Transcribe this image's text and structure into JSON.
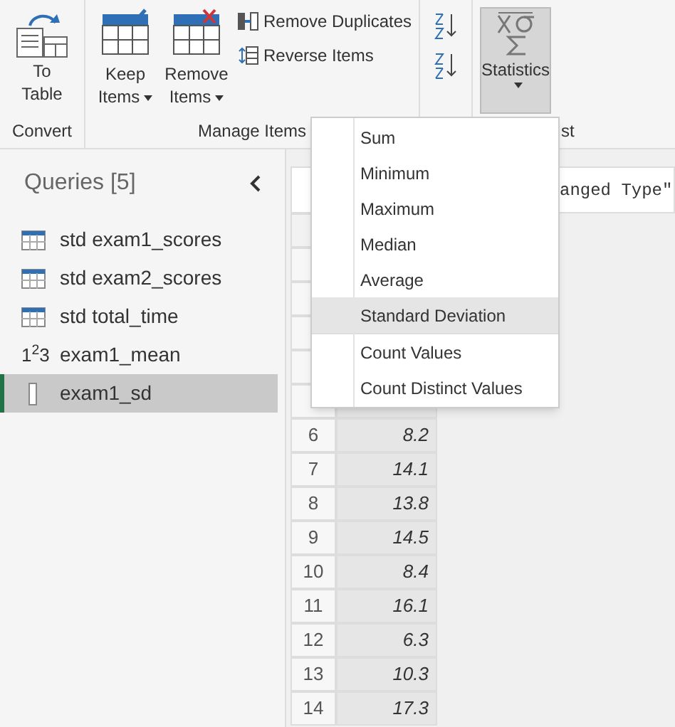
{
  "ribbon": {
    "convert": {
      "label": "To Table",
      "group": "Convert"
    },
    "manage": {
      "keep": "Keep Items",
      "remove": "Remove Items",
      "duplicates": "Remove Duplicates",
      "reverse": "Reverse Items",
      "group": "Manage Items"
    },
    "statistics": {
      "label": "Statistics",
      "pressed": true,
      "group": "st"
    }
  },
  "menu": [
    {
      "label": "Sum",
      "selected": false
    },
    {
      "label": "Minimum",
      "selected": false
    },
    {
      "label": "Maximum",
      "selected": false
    },
    {
      "label": "Median",
      "selected": false
    },
    {
      "label": "Average",
      "selected": false
    },
    {
      "label": "Standard Deviation",
      "selected": true
    },
    {
      "label": "Count Values",
      "selected": false
    },
    {
      "label": "Count Distinct Values",
      "selected": false
    }
  ],
  "queries": {
    "title": "Queries [5]",
    "items": [
      {
        "kind": "table",
        "name": "std exam1_scores",
        "selected": false
      },
      {
        "kind": "table",
        "name": "std exam2_scores",
        "selected": false
      },
      {
        "kind": "table",
        "name": "std total_time",
        "selected": false
      },
      {
        "kind": "number",
        "icon_text": "1$^{2}$3",
        "name": "exam1_mean",
        "selected": false
      },
      {
        "kind": "list",
        "name": "exam1_sd",
        "selected": true
      }
    ]
  },
  "formula": {
    "value": "anged Type\""
  },
  "table": {
    "rows": [
      {
        "index": "6",
        "value": "8.2"
      },
      {
        "index": "7",
        "value": "14.1"
      },
      {
        "index": "8",
        "value": "13.8"
      },
      {
        "index": "9",
        "value": "14.5"
      },
      {
        "index": "10",
        "value": "8.4"
      },
      {
        "index": "11",
        "value": "16.1"
      },
      {
        "index": "12",
        "value": "6.3"
      },
      {
        "index": "13",
        "value": "10.3"
      },
      {
        "index": "14",
        "value": "17.3"
      }
    ]
  }
}
